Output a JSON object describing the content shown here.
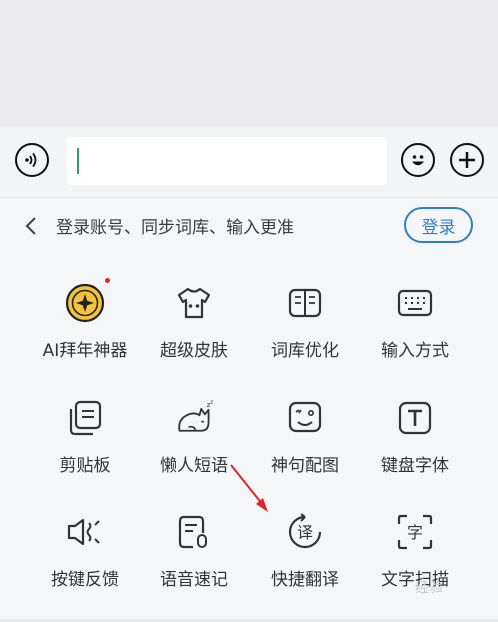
{
  "input_bar": {
    "voice_icon": "voice-input-icon",
    "emoji_icon": "emoji-icon",
    "plus_icon": "plus-icon",
    "field_value": ""
  },
  "login": {
    "prompt": "登录账号、同步词库、输入更准",
    "button_label": "登录"
  },
  "grid": {
    "items": [
      {
        "label": "AI拜年神器",
        "icon": "ai-coin-icon",
        "badge": true
      },
      {
        "label": "超级皮肤",
        "icon": "tshirt-icon"
      },
      {
        "label": "词库优化",
        "icon": "book-icon"
      },
      {
        "label": "输入方式",
        "icon": "keyboard-icon"
      },
      {
        "label": "剪贴板",
        "icon": "clipboard-icon"
      },
      {
        "label": "懒人短语",
        "icon": "lazy-cat-icon"
      },
      {
        "label": "神句配图",
        "icon": "image-caption-icon"
      },
      {
        "label": "键盘字体",
        "icon": "font-t-icon"
      },
      {
        "label": "按键反馈",
        "icon": "vibration-icon"
      },
      {
        "label": "语音速记",
        "icon": "voice-memo-icon"
      },
      {
        "label": "快捷翻译",
        "icon": "translate-icon"
      },
      {
        "label": "文字扫描",
        "icon": "text-scan-icon"
      }
    ]
  },
  "watermark": "经验",
  "colors": {
    "accent": "#2f7fc7",
    "badge": "#e02424",
    "cursor": "#2e9f6a",
    "annotation_arrow": "#d8282c"
  }
}
